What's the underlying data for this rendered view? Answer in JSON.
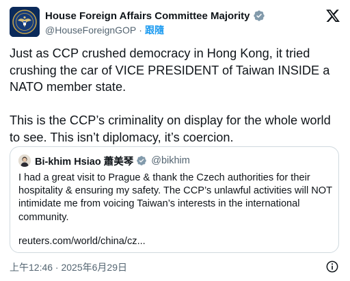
{
  "author": {
    "name": "House Foreign Affairs Committee Majority",
    "handle": "@HouseForeignGOP",
    "separator": "·",
    "follow_label": "跟隨"
  },
  "tweet": {
    "paragraphs": [
      "Just as CCP crushed democracy in Hong Kong, it tried crushing the car of VICE PRESIDENT of Taiwan INSIDE a NATO member state.",
      "This is the CCP’s criminality on display for the whole world to see. This isn’t diplomacy, it’s coercion."
    ]
  },
  "quote": {
    "name": "Bi-khim Hsiao 蕭美琴",
    "handle": "@bikhim",
    "text": "I had a great visit to Prague & thank the Czech authorities for their hospitality & ensuring my safety.  The CCP’s unlawful activities will NOT intimidate me from voicing Taiwan’s interests in the international community.",
    "link": "reuters.com/world/china/cz..."
  },
  "footer": {
    "timestamp": "上午12:46 · 2025年6月29日"
  },
  "icons": {
    "verified": "verified-badge-icon",
    "platform": "x-logo-icon",
    "info": "info-icon"
  },
  "colors": {
    "accent": "#1d9bf0",
    "secondary_text": "#536471",
    "border": "#cfd9de"
  }
}
